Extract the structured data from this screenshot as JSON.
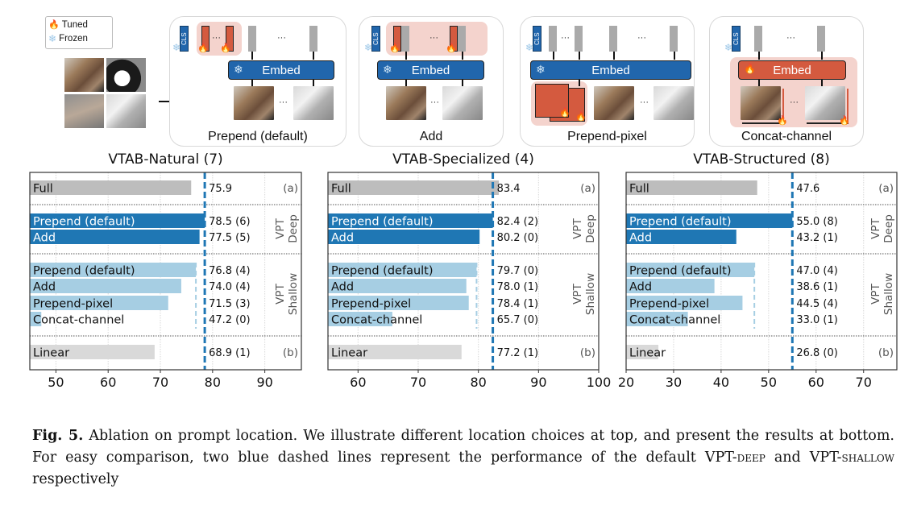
{
  "legend": {
    "items": [
      {
        "icon": "flame-icon",
        "glyph": "🔥",
        "label": "Tuned"
      },
      {
        "icon": "snowflake-icon",
        "glyph": "❄",
        "label": "Frozen"
      }
    ]
  },
  "diagram": {
    "cls_label": "CLS",
    "embed_label": "Embed",
    "ellipsis": "···",
    "panels": [
      {
        "id": "prepend",
        "label": "Prepend (default)"
      },
      {
        "id": "add",
        "label": "Add"
      },
      {
        "id": "prepend-pixel",
        "label": "Prepend-pixel"
      },
      {
        "id": "concat-channel",
        "label": "Concat-channel"
      }
    ]
  },
  "colors": {
    "deep": "#1f77b4",
    "shallow": "#a6cee3",
    "full": "#bdbdbd",
    "linear": "#d9d9d9",
    "tuned": "#d45a3f",
    "embed_frozen": "#2166ac"
  },
  "chart_data": [
    {
      "type": "bar",
      "orientation": "horizontal",
      "title": "VTAB-Natural (7)",
      "xlim": [
        45,
        97
      ],
      "xticks": [
        50,
        60,
        70,
        80,
        90
      ],
      "deep_ref": 78.5,
      "shallow_ref": 76.8,
      "groups": [
        {
          "group": "(a)",
          "rows": [
            {
              "label": "Full",
              "value": 75.9,
              "text": "75.9",
              "kind": "full"
            }
          ]
        },
        {
          "group": "VPT Deep",
          "rows": [
            {
              "label": "Prepend (default)",
              "value": 78.5,
              "text": "78.5 (6)",
              "kind": "deep"
            },
            {
              "label": "Add",
              "value": 77.5,
              "text": "77.5 (5)",
              "kind": "deep"
            }
          ]
        },
        {
          "group": "VPT Shallow",
          "rows": [
            {
              "label": "Prepend (default)",
              "value": 76.8,
              "text": "76.8 (4)",
              "kind": "shallow"
            },
            {
              "label": "Add",
              "value": 74.0,
              "text": "74.0 (4)",
              "kind": "shallow"
            },
            {
              "label": "Prepend-pixel",
              "value": 71.5,
              "text": "71.5 (3)",
              "kind": "shallow"
            },
            {
              "label": "Concat-channel",
              "value": 47.2,
              "text": "47.2 (0)",
              "kind": "shallow"
            }
          ]
        },
        {
          "group": "(b)",
          "rows": [
            {
              "label": "Linear",
              "value": 68.9,
              "text": "68.9 (1)",
              "kind": "linear"
            }
          ]
        }
      ]
    },
    {
      "type": "bar",
      "orientation": "horizontal",
      "title": "VTAB-Specialized (4)",
      "xlim": [
        55,
        100
      ],
      "xticks": [
        60,
        70,
        80,
        90,
        100
      ],
      "deep_ref": 82.4,
      "shallow_ref": 79.7,
      "groups": [
        {
          "group": "(a)",
          "rows": [
            {
              "label": "Full",
              "value": 83.4,
              "text": "83.4",
              "kind": "full"
            }
          ]
        },
        {
          "group": "VPT Deep",
          "rows": [
            {
              "label": "Prepend (default)",
              "value": 82.4,
              "text": "82.4 (2)",
              "kind": "deep"
            },
            {
              "label": "Add",
              "value": 80.2,
              "text": "80.2 (0)",
              "kind": "deep"
            }
          ]
        },
        {
          "group": "VPT Shallow",
          "rows": [
            {
              "label": "Prepend (default)",
              "value": 79.7,
              "text": "79.7 (0)",
              "kind": "shallow"
            },
            {
              "label": "Add",
              "value": 78.0,
              "text": "78.0 (1)",
              "kind": "shallow"
            },
            {
              "label": "Prepend-pixel",
              "value": 78.4,
              "text": "78.4 (1)",
              "kind": "shallow"
            },
            {
              "label": "Concat-channel",
              "value": 65.7,
              "text": "65.7 (0)",
              "kind": "shallow"
            }
          ]
        },
        {
          "group": "(b)",
          "rows": [
            {
              "label": "Linear",
              "value": 77.2,
              "text": "77.2 (1)",
              "kind": "linear"
            }
          ]
        }
      ]
    },
    {
      "type": "bar",
      "orientation": "horizontal",
      "title": "VTAB-Structured (8)",
      "xlim": [
        20,
        77
      ],
      "xticks": [
        20,
        30,
        40,
        50,
        60,
        70
      ],
      "deep_ref": 55.0,
      "shallow_ref": 47.0,
      "groups": [
        {
          "group": "(a)",
          "rows": [
            {
              "label": "Full",
              "value": 47.6,
              "text": "47.6",
              "kind": "full"
            }
          ]
        },
        {
          "group": "VPT Deep",
          "rows": [
            {
              "label": "Prepend (default)",
              "value": 55.0,
              "text": "55.0 (8)",
              "kind": "deep"
            },
            {
              "label": "Add",
              "value": 43.2,
              "text": "43.2 (1)",
              "kind": "deep"
            }
          ]
        },
        {
          "group": "VPT Shallow",
          "rows": [
            {
              "label": "Prepend (default)",
              "value": 47.0,
              "text": "47.0 (4)",
              "kind": "shallow"
            },
            {
              "label": "Add",
              "value": 38.6,
              "text": "38.6 (1)",
              "kind": "shallow"
            },
            {
              "label": "Prepend-pixel",
              "value": 44.5,
              "text": "44.5 (4)",
              "kind": "shallow"
            },
            {
              "label": "Concat-channel",
              "value": 33.0,
              "text": "33.0 (1)",
              "kind": "shallow"
            }
          ]
        },
        {
          "group": "(b)",
          "rows": [
            {
              "label": "Linear",
              "value": 26.8,
              "text": "26.8 (0)",
              "kind": "linear"
            }
          ]
        }
      ]
    }
  ],
  "caption": {
    "label": "Fig. 5.",
    "part1": " Ablation on prompt location. We illustrate different location choices at top, and present the results at bottom. For easy comparison, two blue dashed lines represent the performance of the default VPT-",
    "deep": "deep",
    "part2": " and VPT-",
    "shallow": "shallow",
    "part3": " respectively"
  }
}
